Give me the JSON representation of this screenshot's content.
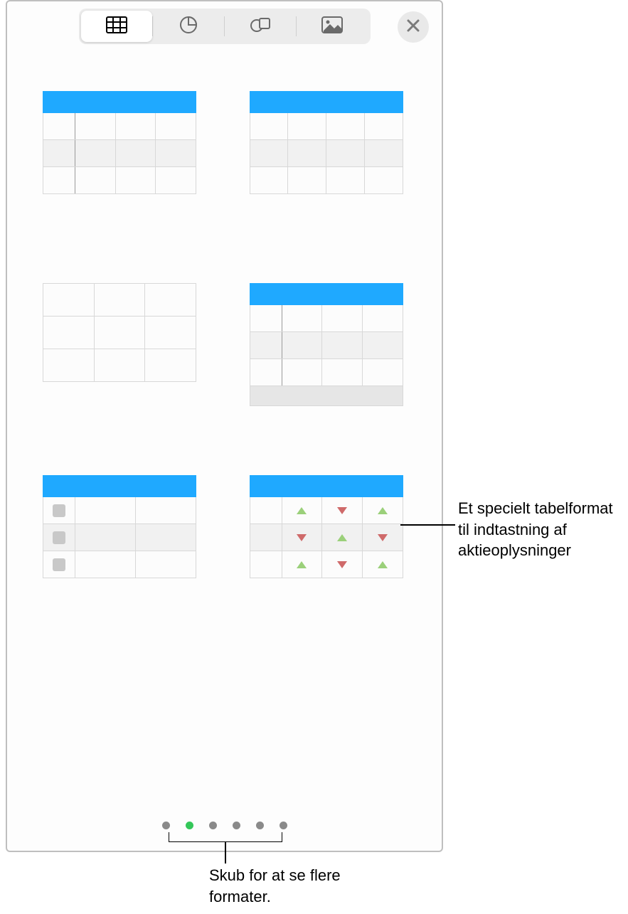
{
  "toolbar": {
    "tabs": [
      "table",
      "chart",
      "shape",
      "image"
    ],
    "active_index": 0
  },
  "pager": {
    "count": 6,
    "active_index": 1
  },
  "callouts": {
    "stock": "Et specielt tabelformat til indtastning af aktieoplysninger",
    "swipe": "Skub for at se flere formater."
  },
  "thumbs": {
    "t1": "table-header-firstcol",
    "t2": "table-header-basic",
    "t3": "table-plain",
    "t4": "table-header-footer",
    "t5": "table-checklist",
    "t6": "table-stock"
  }
}
